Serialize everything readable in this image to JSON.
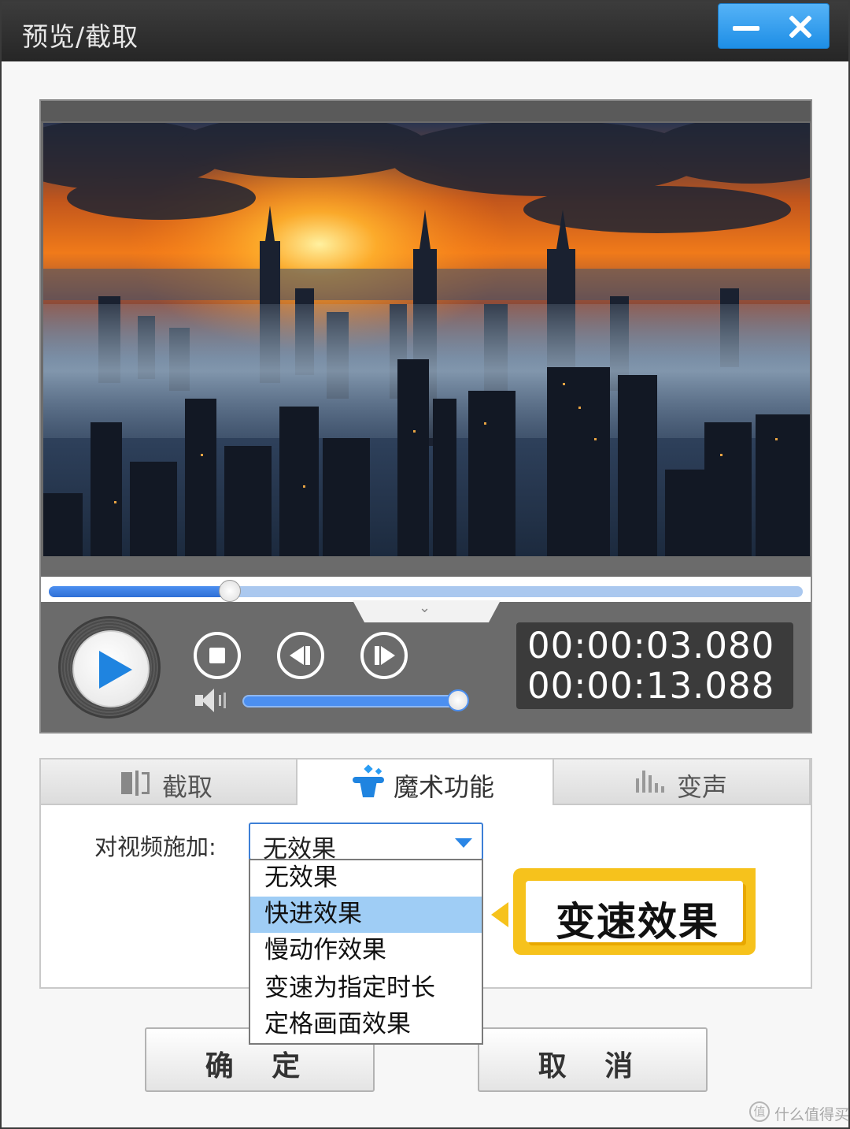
{
  "window": {
    "title": "预览/截取"
  },
  "player": {
    "progress_fraction": 0.24,
    "volume_fraction": 0.97,
    "current_time": "00:00:03.080",
    "total_time": "00:00:13.088"
  },
  "tabs": [
    {
      "label": "截取",
      "icon": "clip-icon",
      "active": false
    },
    {
      "label": "魔术功能",
      "icon": "magic-hat-icon",
      "active": true
    },
    {
      "label": "变声",
      "icon": "voice-wave-icon",
      "active": false
    }
  ],
  "magic": {
    "apply_label": "对视频施加:",
    "selected_value": "无效果",
    "options": [
      "无效果",
      "快进效果",
      "慢动作效果",
      "变速为指定时长",
      "定格画面效果"
    ],
    "highlighted_index": 1
  },
  "callout": {
    "text": "变速效果",
    "color": "#f6c21c"
  },
  "buttons": {
    "ok": "确 定",
    "cancel": "取 消"
  },
  "watermark": {
    "icon_glyph": "值",
    "text": "什么值得买"
  },
  "colors": {
    "accent": "#1f84e0",
    "titlebar": "#2e2e2e",
    "selection": "#9fcdf5"
  }
}
